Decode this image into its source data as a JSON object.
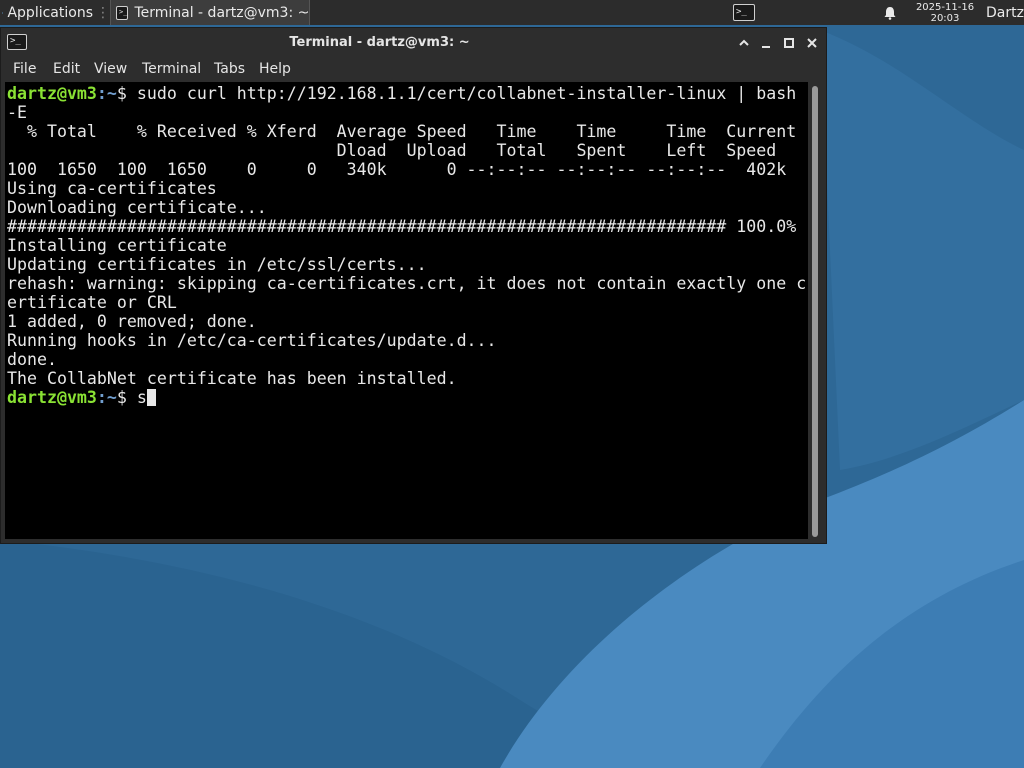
{
  "colors": {
    "desktop_dark": "#1f4f78",
    "desktop_light": "#3b7ab0",
    "panel_bg": "#2c2c2c",
    "prompt_user": "#8ae234",
    "prompt_path": "#729fcf"
  },
  "panel": {
    "apps_label": "Applications",
    "apps_icon": "xfce-mouse-icon",
    "task_label": "Terminal - dartz@vm3: ~",
    "tray_term_glyph": ">_",
    "bell_icon": "bell-icon",
    "date": "2025-11-16",
    "time": "20:03",
    "user": "Dartz"
  },
  "window": {
    "title": "Terminal - dartz@vm3: ~",
    "menu": [
      "File",
      "Edit",
      "View",
      "Terminal",
      "Tabs",
      "Help"
    ],
    "buttons": {
      "up": "⌃",
      "minimize": "–",
      "maximize": "□",
      "close": "✕"
    }
  },
  "terminal": {
    "user_host": "dartz@vm3",
    "path_sep": ":~",
    "dollar": "$ ",
    "command": "sudo curl http://192.168.1.1/cert/collabnet-installer-linux | bash\n-E",
    "output": "  % Total    % Received % Xferd  Average Speed   Time    Time     Time  Current\n                                 Dload  Upload   Total   Spent    Left  Speed\n100  1650  100  1650    0     0   340k      0 --:--:-- --:--:-- --:--:--  402k\nUsing ca-certificates\nDownloading certificate...\n######################################################################## 100.0%\nInstalling certificate\nUpdating certificates in /etc/ssl/certs...\nrehash: warning: skipping ca-certificates.crt, it does not contain exactly one c\nertificate or CRL\n1 added, 0 removed; done.\nRunning hooks in /etc/ca-certificates/update.d...\ndone.\nThe CollabNet certificate has been installed.\n",
    "current_input": "s"
  }
}
